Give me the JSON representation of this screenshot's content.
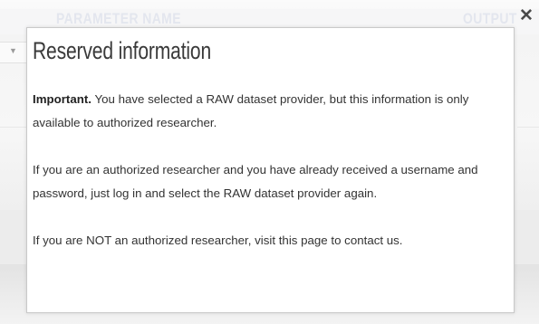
{
  "background": {
    "table_header": {
      "param_col": "PARAMETER NAME",
      "output_col": "OUTPUT"
    },
    "select_arrow_icon": "chevron-down-icon"
  },
  "modal": {
    "title": "Reserved information",
    "close_icon": "close-icon",
    "close_glyph": "✕",
    "p1": {
      "strong": "Important.",
      "text": " You have selected a RAW dataset provider, but this information is only available to authorized researcher."
    },
    "p2": {
      "text": "If you are an authorized researcher and you have already received a username and password, just log in and select the RAW dataset provider again."
    },
    "p3": {
      "before": "If you are NOT an authorized researcher, visit ",
      "link": "this page",
      "after": " to contact us."
    }
  },
  "colors": {
    "title": "#3a3a3a",
    "body_text": "#333333",
    "modal_border": "#c9c9c9",
    "background_header_text": "#e3e6ee"
  }
}
